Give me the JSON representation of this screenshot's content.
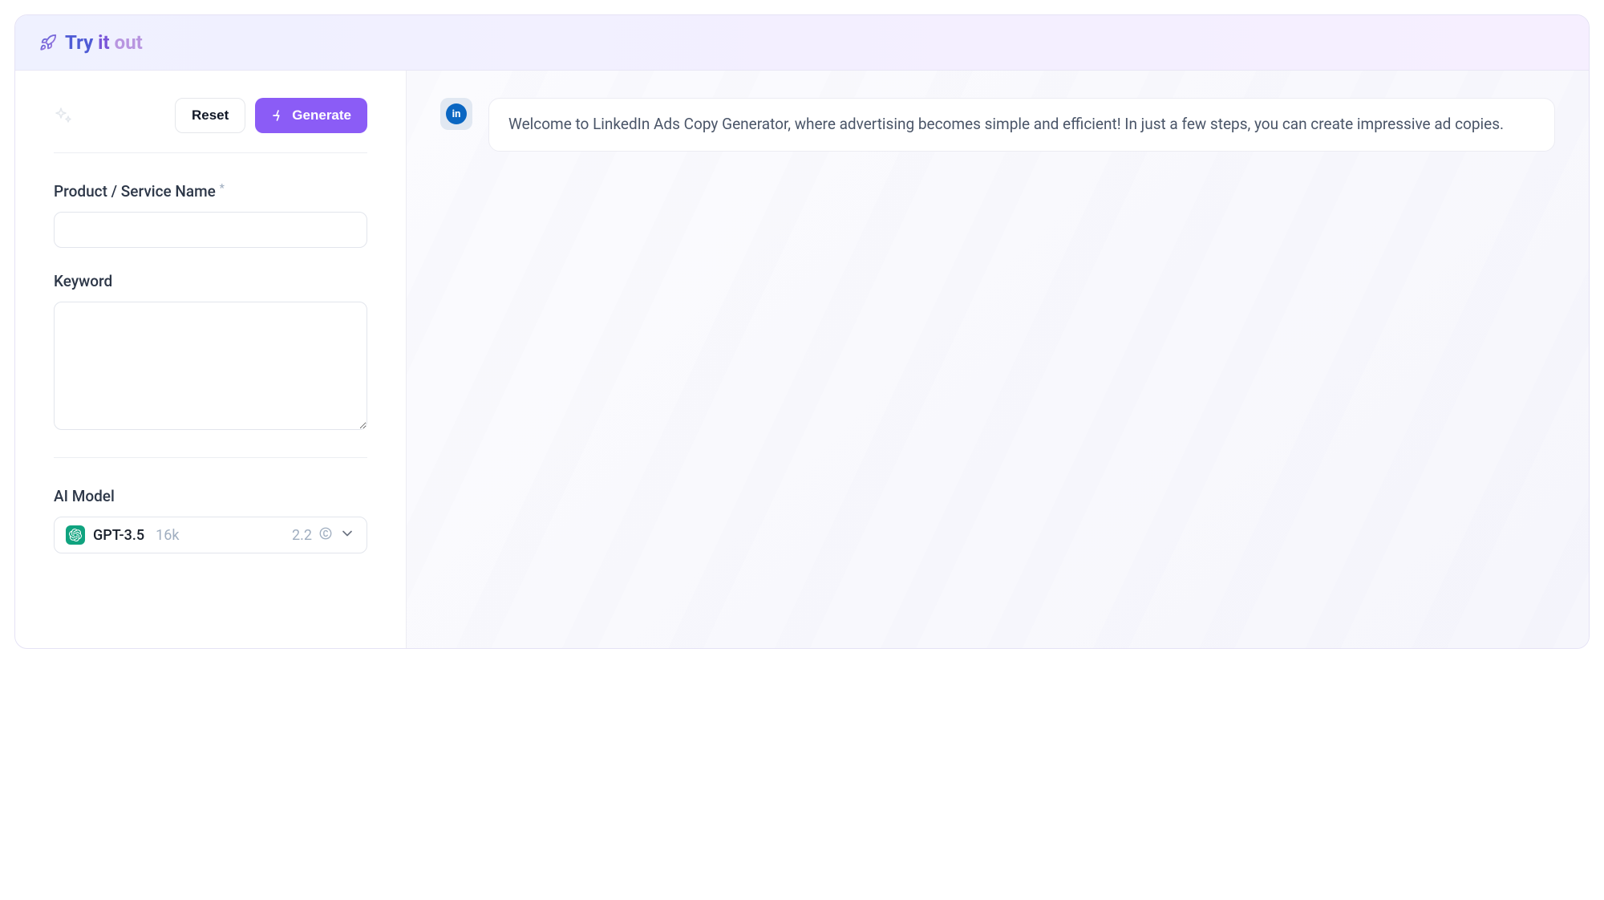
{
  "header": {
    "title_try": "Try",
    "title_it": "it",
    "title_out": "out"
  },
  "actions": {
    "reset_label": "Reset",
    "generate_label": "Generate"
  },
  "form": {
    "product_label": "Product / Service Name",
    "product_value": "",
    "keyword_label": "Keyword",
    "keyword_value": "",
    "model_label": "AI Model",
    "model_name": "GPT-3.5",
    "model_size": "16k",
    "model_cost": "2.2"
  },
  "chat": {
    "welcome_message": "Welcome to LinkedIn Ads Copy Generator, where advertising becomes simple and efficient! In just a few steps, you can create impressive ad copies."
  }
}
